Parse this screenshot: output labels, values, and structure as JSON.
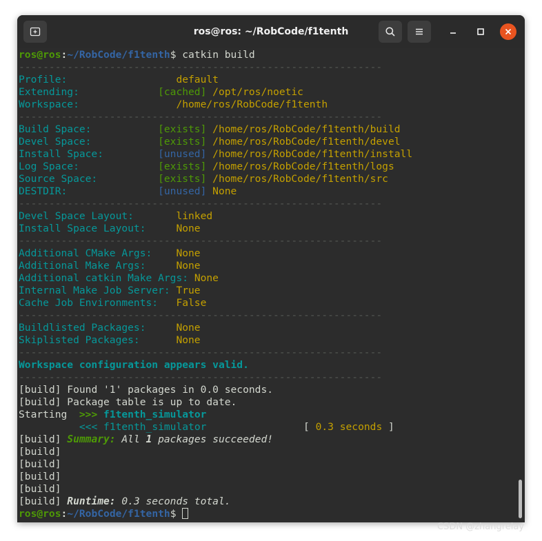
{
  "window": {
    "title": "ros@ros: ~/RobCode/f1tenth"
  },
  "icons": {
    "new_tab": "new-tab-icon",
    "search": "search-icon",
    "menu": "hamburger-menu-icon",
    "minimize": "minimize-icon",
    "maximize": "maximize-icon",
    "close": "close-icon"
  },
  "colors": {
    "terminal_bg": "#2c2c2c",
    "close_button": "#e95420",
    "prompt_user": "#4e9a06",
    "prompt_path": "#3465a4",
    "label": "#06989a",
    "value": "#c4a000"
  },
  "prompt": {
    "user": "ros@ros",
    "sep": ":",
    "path": "~/RobCode/f1tenth",
    "sign": "$ "
  },
  "command": "catkin build",
  "separator": "------------------------------------------------------------",
  "config_groups": [
    [
      {
        "label": "Profile:                  ",
        "status": "",
        "value": "default"
      },
      {
        "label": "Extending:             ",
        "status": "[cached] ",
        "value": "/opt/ros/noetic"
      },
      {
        "label": "Workspace:                ",
        "status": "",
        "value": "/home/ros/RobCode/f1tenth"
      }
    ],
    [
      {
        "label": "Build Space:           ",
        "status": "[exists] ",
        "value": "/home/ros/RobCode/f1tenth/build"
      },
      {
        "label": "Devel Space:           ",
        "status": "[exists] ",
        "value": "/home/ros/RobCode/f1tenth/devel"
      },
      {
        "label": "Install Space:         ",
        "status": "[unused] ",
        "value": "/home/ros/RobCode/f1tenth/install"
      },
      {
        "label": "Log Space:             ",
        "status": "[exists] ",
        "value": "/home/ros/RobCode/f1tenth/logs"
      },
      {
        "label": "Source Space:          ",
        "status": "[exists] ",
        "value": "/home/ros/RobCode/f1tenth/src"
      },
      {
        "label": "DESTDIR:               ",
        "status": "[unused] ",
        "value": "None"
      }
    ],
    [
      {
        "label": "Devel Space Layout:       ",
        "status": "",
        "value": "linked"
      },
      {
        "label": "Install Space Layout:     ",
        "status": "",
        "value": "None"
      }
    ],
    [
      {
        "label": "Additional CMake Args:    ",
        "status": "",
        "value": "None"
      },
      {
        "label": "Additional Make Args:     ",
        "status": "",
        "value": "None"
      },
      {
        "label": "Additional catkin Make Args: ",
        "status": "",
        "value": "None"
      },
      {
        "label": "Internal Make Job Server: ",
        "status": "",
        "value": "True"
      },
      {
        "label": "Cache Job Environments:   ",
        "status": "",
        "value": "False"
      }
    ],
    [
      {
        "label": "Buildlisted Packages:     ",
        "status": "",
        "value": "None"
      },
      {
        "label": "Skiplisted Packages:      ",
        "status": "",
        "value": "None"
      }
    ]
  ],
  "valid_message": "Workspace configuration appears valid.",
  "build": {
    "prefix": "[build] ",
    "found": "Found '1' packages in 0.0 seconds.",
    "table": "Package table is up to date.",
    "starting_label": "Starting  ",
    "start_arrow": ">>> ",
    "package": "f1tenth_simulator",
    "indent": "          ",
    "finish_arrow": "<<< ",
    "finish_pad": "                ",
    "time_open": "[ ",
    "time_value": "0.3 seconds",
    "time_close": " ]",
    "summary_label": "Summary:",
    "summary_pre": " All ",
    "summary_count": "1",
    "summary_post": " packages succeeded!",
    "runtime_label": "Runtime:",
    "runtime_text": " 0.3 seconds total."
  },
  "watermark": "CSDN @zhangrelay"
}
